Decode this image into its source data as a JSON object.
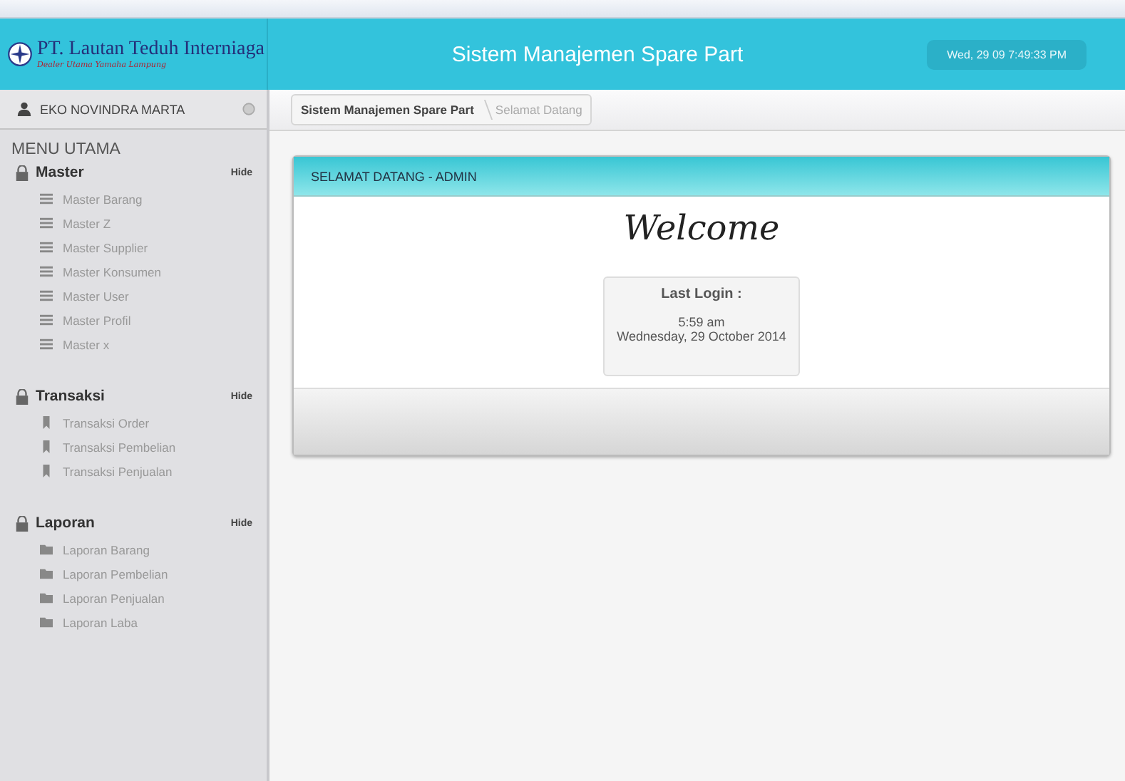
{
  "header": {
    "company": "PT. Lautan Teduh Interniaga",
    "tagline": "Dealer Utama Yamaha Lampung",
    "title": "Sistem Manajemen Spare Part",
    "clock": "Wed, 29 09 7:49:33 PM"
  },
  "user": {
    "name": "EKO NOVINDRA MARTA"
  },
  "breadcrumb": [
    {
      "label": "Sistem Manajemen Spare Part",
      "selected": false
    },
    {
      "label": "Selamat Datang",
      "selected": true
    }
  ],
  "sidebar": {
    "heading": "MENU UTAMA",
    "sections": [
      {
        "title": "Master",
        "toggle": "Hide",
        "kind": "list",
        "items": [
          "Master Barang",
          "Master Z",
          "Master Supplier",
          "Master Konsumen",
          "Master User",
          "Master Profil",
          "Master x"
        ]
      },
      {
        "title": "Transaksi",
        "toggle": "Hide",
        "kind": "bookmark",
        "items": [
          "Transaksi Order",
          "Transaksi Pembelian",
          "Transaksi Penjualan"
        ]
      },
      {
        "title": "Laporan",
        "toggle": "Hide",
        "kind": "folder",
        "items": [
          "Laporan Barang",
          "Laporan Pembelian",
          "Laporan Penjualan",
          "Laporan Laba"
        ]
      }
    ]
  },
  "panel": {
    "title": "SELAMAT DATANG - ADMIN",
    "welcome": "Welcome",
    "last_login": {
      "label": "Last Login :",
      "time": "5:59 am",
      "date": "Wednesday, 29 October 2014"
    }
  }
}
